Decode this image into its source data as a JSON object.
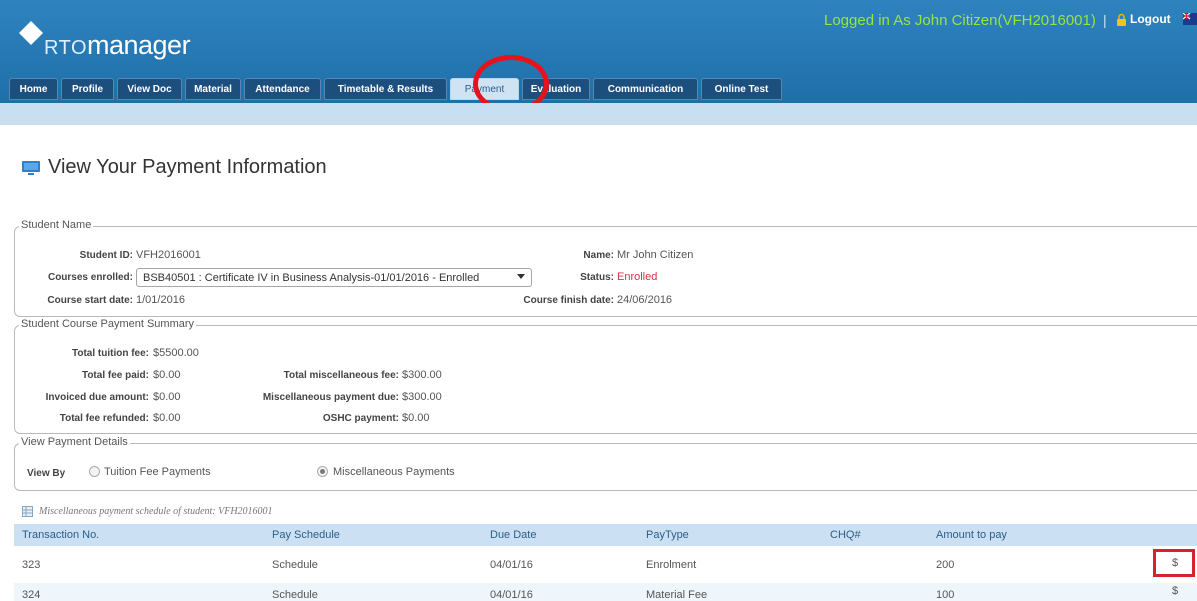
{
  "header": {
    "logo_prefix": "RTO",
    "logo_text": "manager",
    "login_text": "Logged in As John Citizen(VFH2016001)",
    "separator": "|",
    "logout_label": "Logout"
  },
  "nav": {
    "tabs": [
      {
        "label": "Home"
      },
      {
        "label": "Profile"
      },
      {
        "label": "View Doc"
      },
      {
        "label": "Material"
      },
      {
        "label": "Attendance"
      },
      {
        "label": "Timetable & Results"
      },
      {
        "label": "Payment",
        "active": true
      },
      {
        "label": "Evaluation"
      },
      {
        "label": "Communication"
      },
      {
        "label": "Online Test"
      }
    ]
  },
  "page": {
    "title": "View Your Payment Information"
  },
  "student": {
    "legend": "Student Name",
    "id_label": "Student ID:",
    "id_value": "VFH2016001",
    "courses_label": "Courses enrolled:",
    "course_selected": "BSB40501 : Certificate IV in Business Analysis-01/01/2016 - Enrolled",
    "start_label": "Course start date:",
    "start_value": "1/01/2016",
    "name_label": "Name:",
    "name_value": "Mr John Citizen",
    "status_label": "Status:",
    "status_value": "Enrolled",
    "finish_label": "Course finish date:",
    "finish_value": "24/06/2016"
  },
  "summary": {
    "legend": "Student Course Payment Summary",
    "tuition_label": "Total tuition fee:",
    "tuition_value": "$5500.00",
    "paid_label": "Total fee paid:",
    "paid_value": "$0.00",
    "invoiced_label": "Invoiced due amount:",
    "invoiced_value": "$0.00",
    "refunded_label": "Total fee refunded:",
    "refunded_value": "$0.00",
    "misc_fee_label": "Total miscellaneous fee:",
    "misc_fee_value": "$300.00",
    "misc_due_label": "Miscellaneous payment due:",
    "misc_due_value": "$300.00",
    "oshc_label": "OSHC payment:",
    "oshc_value": "$0.00"
  },
  "details": {
    "legend": "View Payment Details",
    "view_by_label": "View By",
    "option_tuition": "Tuition Fee Payments",
    "option_misc": "Miscellaneous Payments",
    "selected": "misc"
  },
  "table": {
    "caption": "Miscellaneous payment schedule of student: VFH2016001",
    "headers": [
      "Transaction No.",
      "Pay Schedule",
      "Due Date",
      "PayType",
      "CHQ#",
      "Amount to pay"
    ],
    "rows": [
      {
        "transaction": "323",
        "schedule": "Schedule",
        "due_date": "04/01/16",
        "pay_type": "Enrolment",
        "chq": "",
        "amount": "200",
        "action": "$"
      },
      {
        "transaction": "324",
        "schedule": "Schedule",
        "due_date": "04/01/16",
        "pay_type": "Material Fee",
        "chq": "",
        "amount": "100",
        "action": "$"
      }
    ]
  },
  "colors": {
    "header_blue": "#2578b5",
    "nav_tab": "#1d4f7e",
    "login_green": "#9be33d",
    "highlight_red": "#e8121b",
    "status_red": "#d2334a"
  }
}
